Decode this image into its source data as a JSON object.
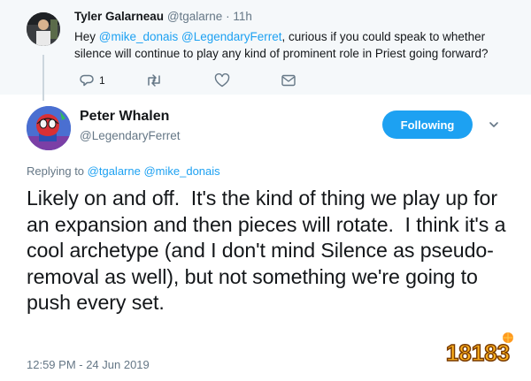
{
  "parent_tweet": {
    "display_name": "Tyler Galarneau",
    "handle": "@tgalarne",
    "separator": "·",
    "time_ago": "11h",
    "text_before": "Hey ",
    "mention1": "@mike_donais",
    "mention2": "@LegendaryFerret",
    "text_after": ", curious if you could speak to whether silence will continue to play any kind of prominent role in Priest going forward?",
    "actions": {
      "reply_icon": "reply-icon",
      "reply_count": "1",
      "retweet_icon": "retweet-icon",
      "like_icon": "heart-icon",
      "dm_icon": "envelope-icon"
    }
  },
  "main_tweet": {
    "display_name": "Peter Whalen",
    "handle": "@LegendaryFerret",
    "follow_button": "Following",
    "more_icon": "chevron-down-icon",
    "replying_prefix": "Replying to ",
    "replying_to1": "@tgalarne",
    "replying_to2": "@mike_donais",
    "text": "Likely on and off.  It's the kind of thing we play up for an expansion and then pieces will rotate.  I think it's a cool archetype (and I don't mind Silence as pseudo-removal as well), but not something we're going to push every set.",
    "timestamp": "12:59 PM - 24 Jun 2019"
  },
  "watermark": {
    "logo_text": "18183"
  },
  "colors": {
    "accent": "#1da1f2",
    "muted": "#657786",
    "parent_bg": "#f5f8fa"
  }
}
